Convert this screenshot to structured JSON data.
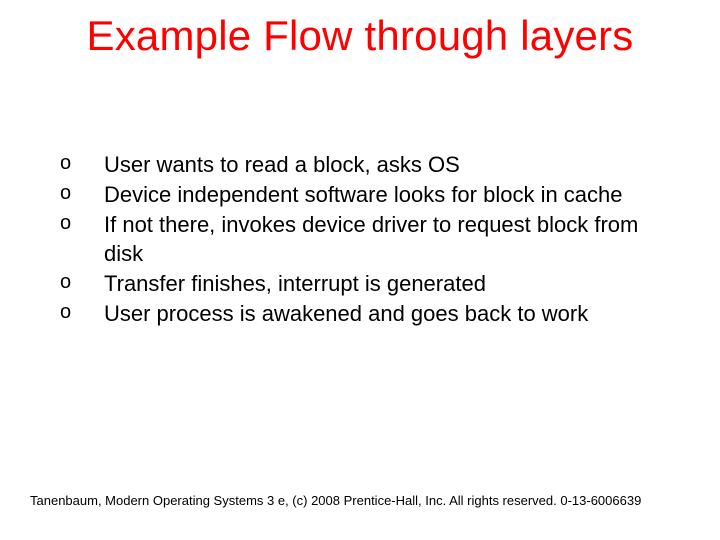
{
  "title": "Example Flow through layers",
  "bullets": {
    "marker": "o",
    "items": [
      "User wants to read a block, asks OS",
      "Device independent software looks for block in cache",
      "If not there, invokes device driver to request block from disk",
      "Transfer finishes, interrupt is generated",
      "User process is awakened and goes back to work"
    ]
  },
  "footer": "Tanenbaum, Modern Operating Systems 3 e, (c) 2008 Prentice-Hall, Inc. All rights reserved. 0-13-6006639"
}
